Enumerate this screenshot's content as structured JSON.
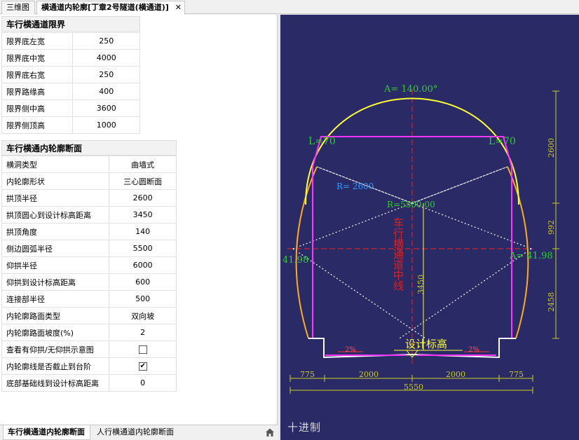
{
  "tabs": {
    "view3d": "三维图",
    "outline": "横通道内轮廓[丁章2号隧道(横通道)]",
    "close": "✕"
  },
  "clearance": {
    "title": "车行横通道限界",
    "rows": [
      {
        "label": "限界底左宽",
        "value": "250"
      },
      {
        "label": "限界底中宽",
        "value": "4000"
      },
      {
        "label": "限界底右宽",
        "value": "250"
      },
      {
        "label": "限界路缘高",
        "value": "400"
      },
      {
        "label": "限界侧中高",
        "value": "3600"
      },
      {
        "label": "限界侧顶高",
        "value": "1000"
      }
    ]
  },
  "section": {
    "title": "车行横通内轮廓断面",
    "rows": [
      {
        "label": "横洞类型",
        "value": "曲墙式"
      },
      {
        "label": "内轮廓形状",
        "value": "三心圆断面"
      },
      {
        "label": "拱顶半径",
        "value": "2600"
      },
      {
        "label": "拱顶圆心到设计标高距离",
        "value": "3450"
      },
      {
        "label": "拱顶角度",
        "value": "140"
      },
      {
        "label": "侧边圆弧半径",
        "value": "5500"
      },
      {
        "label": "仰拱半径",
        "value": "6000"
      },
      {
        "label": "仰拱到设计标高距离",
        "value": "600"
      },
      {
        "label": "连接部半径",
        "value": "500"
      },
      {
        "label": "内轮廓路面类型",
        "value": "双向坡"
      },
      {
        "label": "内轮廓路面坡度(%)",
        "value": "2"
      },
      {
        "label": "查看有仰拱/无仰拱示意图",
        "value": "",
        "checked": false
      },
      {
        "label": "内轮廓线是否截止到台阶",
        "value": "",
        "checked": true
      },
      {
        "label": "底部基础线到设计标高距离",
        "value": "0"
      }
    ]
  },
  "bottom_tabs": {
    "vehicle": "车行横通道内轮廓断面",
    "pedestrian": "人行横通道内轮廓断面"
  },
  "drawing": {
    "angle_label": "A= 140.00°",
    "left_L": "L=70",
    "right_L": "L=70",
    "radius_top": "R= 2600",
    "radius_center": "R=5500.00",
    "left_angle": "41.98",
    "right_angle": "A= 41.98",
    "vertical_text": "车行横通道中线",
    "center_dim": "3450",
    "design_level": "设计标高",
    "slope_left": "2%",
    "slope_right": "2%",
    "dim_h": [
      "775",
      "2000",
      "2000",
      "775"
    ],
    "dim_total": "5550",
    "dim_v": [
      "2600",
      "992",
      "2458"
    ],
    "mode": "十进制"
  },
  "colors": {
    "canvas_bg": "#2a2a66",
    "arch": "#ffff33",
    "inner": "#ff33ff",
    "sidewall": "#ffaa22",
    "centerline": "#ee2222",
    "dims": "#cccc22",
    "labels": "#33cc33"
  }
}
